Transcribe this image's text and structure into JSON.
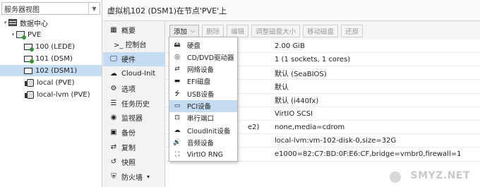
{
  "left": {
    "view_select": "服务器视图",
    "tree": [
      {
        "label": "数据中心",
        "icon": "datacenter-icon",
        "indent": 0,
        "twist": "▾"
      },
      {
        "label": "PVE",
        "icon": "node-icon",
        "indent": 1,
        "twist": "▾"
      },
      {
        "label": "100 (LEDE)",
        "icon": "vm-icon",
        "indent": 2,
        "running": true
      },
      {
        "label": "101 (DSM)",
        "icon": "vm-icon",
        "indent": 2,
        "running": true
      },
      {
        "label": "102 (DSM1)",
        "icon": "vm-icon",
        "indent": 2,
        "running": false,
        "selected": true
      },
      {
        "label": "local (PVE)",
        "icon": "storage-icon",
        "indent": 2
      },
      {
        "label": "local-lvm (PVE)",
        "icon": "storage-icon",
        "indent": 2
      }
    ]
  },
  "header": {
    "title": "虚拟机102 (DSM1)在节点'PVE'上"
  },
  "nav": {
    "items": [
      {
        "label": "概要",
        "icon": "▦",
        "name": "summary"
      },
      {
        "label": ">_ 控制台",
        "icon": "",
        "name": "console"
      },
      {
        "label": "硬件",
        "icon": "🖵",
        "name": "hardware",
        "selected": true
      },
      {
        "label": "Cloud-Init",
        "icon": "☁",
        "name": "cloud-init"
      },
      {
        "label": "选项",
        "icon": "⚙",
        "name": "options"
      },
      {
        "label": "任务历史",
        "icon": "☰",
        "name": "task-history"
      },
      {
        "label": "监视器",
        "icon": "◉",
        "name": "monitor"
      },
      {
        "label": "备份",
        "icon": "▣",
        "name": "backup"
      },
      {
        "label": "复制",
        "icon": "⇄",
        "name": "replication"
      },
      {
        "label": "快照",
        "icon": "↺",
        "name": "snapshots"
      },
      {
        "label": "防火墙",
        "icon": "⛨",
        "name": "firewall",
        "has_children": true
      }
    ]
  },
  "toolbar": {
    "add": "添加",
    "remove": "删除",
    "edit": "编辑",
    "resize": "调整磁盘大小",
    "move": "移动磁盘",
    "revert": "还原"
  },
  "grid": {
    "rows": [
      {
        "key": "",
        "value": "2.00 GiB"
      },
      {
        "key": "",
        "value": "1 (1 sockets, 1 cores)"
      },
      {
        "key": "",
        "value": "默认 (SeaBIOS)"
      },
      {
        "key": "",
        "value": "默认"
      },
      {
        "key": "",
        "value": "默认 (i440fx)"
      },
      {
        "key": "",
        "value": "VirtIO SCSI"
      },
      {
        "key": "e2)",
        "value": "none,media=cdrom"
      },
      {
        "key": "",
        "value": "local-lvm:vm-102-disk-0,size=32G"
      },
      {
        "key": "",
        "value": "e1000=82:C7:BD:0F:E6:CF,bridge=vmbr0,firewall=1"
      }
    ]
  },
  "menu": {
    "items": [
      {
        "label": "硬盘",
        "icon": "🖴",
        "name": "hard-disk"
      },
      {
        "label": "CD/DVD驱动器",
        "icon": "◎",
        "name": "cd-dvd"
      },
      {
        "label": "网络设备",
        "icon": "⇄",
        "name": "network-device"
      },
      {
        "label": "EFI磁盘",
        "icon": "▬",
        "name": "efi-disk"
      },
      {
        "label": "USB设备",
        "icon": "⭍",
        "name": "usb-device"
      },
      {
        "label": "PCI设备",
        "icon": "▭",
        "name": "pci-device",
        "highlighted": true
      },
      {
        "label": "串行端口",
        "icon": "⊡",
        "name": "serial-port"
      },
      {
        "label": "CloudInit设备",
        "icon": "☁",
        "name": "cloudinit-device"
      },
      {
        "label": "音频设备",
        "icon": "🔊",
        "name": "audio-device"
      },
      {
        "label": "VirtIO RNG",
        "icon": "⛶",
        "name": "virtio-rng"
      }
    ]
  },
  "watermark": "SMYZ.NET"
}
